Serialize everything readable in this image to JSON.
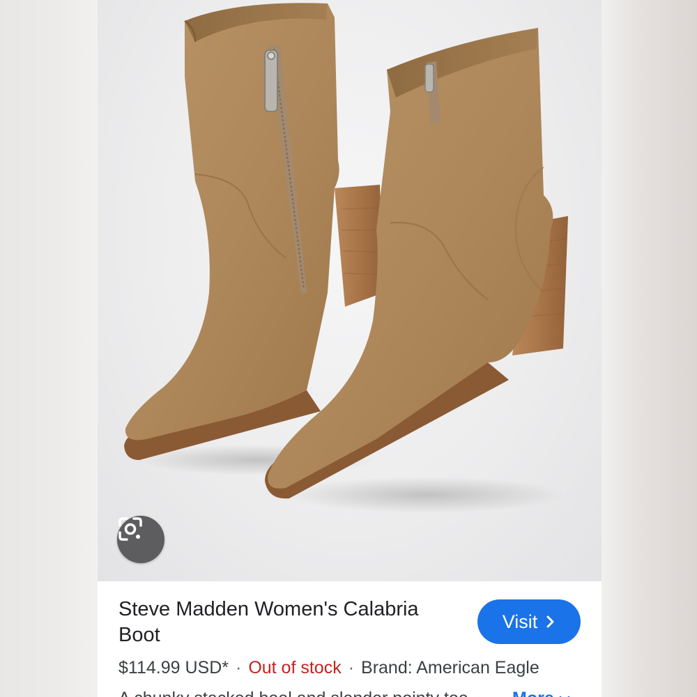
{
  "result": {
    "title": "Steve Madden Women's Calabria Boot",
    "visit_label": "Visit",
    "price": "$114.99 USD*",
    "separator": "·",
    "stock_status": "Out of stock",
    "brand": "Brand: American Eagle",
    "description": "A chunky stacked heel and slender pointy toe ...",
    "more_label": "More"
  },
  "icons": {
    "lens": "google-lens-icon",
    "visit_chevron": "chevron-right-icon",
    "more_chevron": "chevron-down-icon"
  },
  "colors": {
    "accent": "#1a73e8",
    "out_of_stock": "#c5221f",
    "boot_suede": "#b08a5e",
    "heel_wood": "#a8784c"
  }
}
